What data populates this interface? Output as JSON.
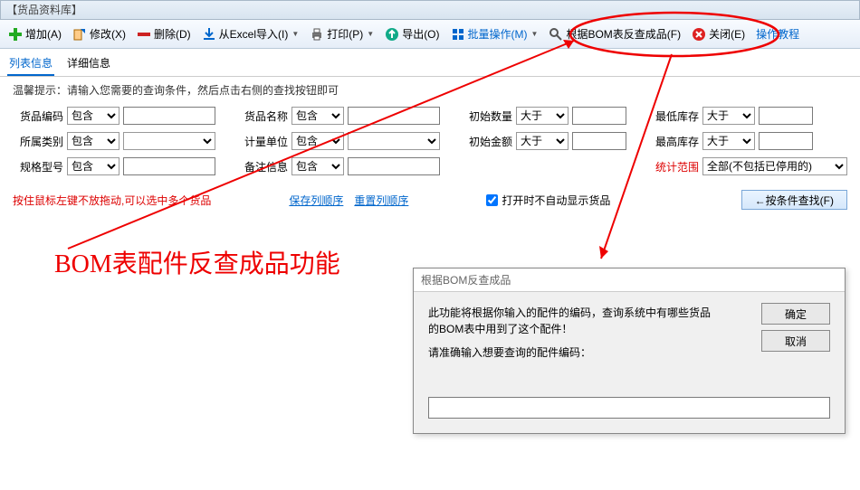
{
  "window_title": "【货品资料库】",
  "toolbar": {
    "add": "增加(A)",
    "edit": "修改(X)",
    "delete": "删除(D)",
    "import": "从Excel导入(I)",
    "print": "打印(P)",
    "export": "导出(O)",
    "batch": "批量操作(M)",
    "bom": "根据BOM表反查成品(F)",
    "close": "关闭(E)",
    "tutorial": "操作教程"
  },
  "tabs": {
    "list": "列表信息",
    "detail": "详细信息"
  },
  "hint": "温馨提示：请输入您需要的查询条件，然后点击右侧的查找按钮即可",
  "labels": {
    "code": "货品编码",
    "name": "货品名称",
    "initqty": "初始数量",
    "minstock": "最低库存",
    "category": "所属类别",
    "unit": "计量单位",
    "initamt": "初始金额",
    "maxstock": "最高库存",
    "spec": "规格型号",
    "remark": "备注信息",
    "scope": "统计范围"
  },
  "ops": {
    "contain": "包含",
    "gt": "大于"
  },
  "scope_value": "全部(不包括已停用的)",
  "dragtip": "按住鼠标左键不放拖动,可以选中多个货品",
  "links": {
    "savesort": "保存列顺序",
    "resetsort": "重置列顺序"
  },
  "checkbox": "打开时不自动显示货品",
  "searchbtn": "←按条件查找(F)",
  "annotation": "BOM表配件反查成品功能",
  "dialog": {
    "title": "根据BOM反查成品",
    "line1": "此功能将根据你输入的配件的编码，查询系统中有哪些货品的BOM表中用到了这个配件！",
    "line2": "请准确输入想要查询的配件编码：",
    "ok": "确定",
    "cancel": "取消"
  }
}
